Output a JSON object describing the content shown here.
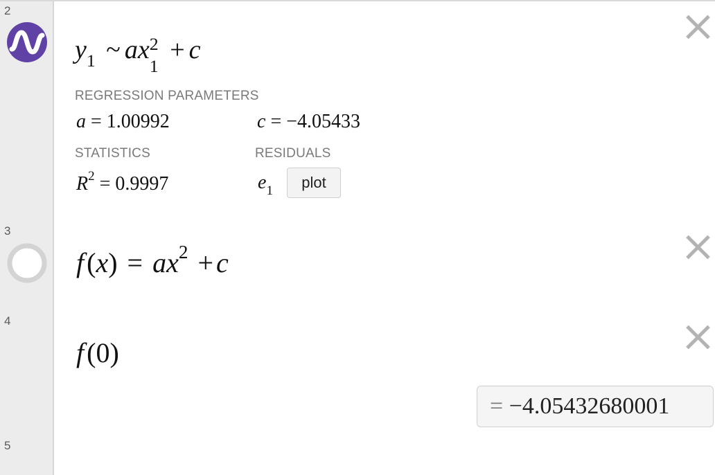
{
  "expressions": [
    {
      "number": "2",
      "type": "regression",
      "formula": {
        "y": "y",
        "y_sub": "1",
        "tilde": "~",
        "a": "a",
        "x": "x",
        "x_sup": "2",
        "x_sub": "1",
        "plus": "+",
        "c": "c"
      },
      "regression_parameters_label": "REGRESSION PARAMETERS",
      "param_a": {
        "name": "a",
        "eq": "=",
        "value": "1.00992"
      },
      "param_c": {
        "name": "c",
        "eq": "=",
        "value": "−4.05433"
      },
      "statistics_label": "STATISTICS",
      "r2": {
        "name": "R",
        "sup": "2",
        "eq": "=",
        "value": "0.9997"
      },
      "residuals_label": "RESIDUALS",
      "residual": {
        "name": "e",
        "sub": "1"
      },
      "plot_button": "plot",
      "icon": "regression-wave-icon",
      "icon_color": "#6042a6"
    },
    {
      "number": "3",
      "type": "function",
      "formula": {
        "f": "f",
        "lparen": "(",
        "x": "x",
        "rparen": ")",
        "eq": "=",
        "a": "a",
        "x2": "x",
        "sup": "2",
        "plus": "+",
        "c": "c"
      },
      "icon": "hidden-circle-icon"
    },
    {
      "number": "4",
      "type": "evaluation",
      "formula": {
        "f": "f",
        "lparen": "(",
        "arg": "0",
        "rparen": ")"
      },
      "result": {
        "eq": "=",
        "value": "−4.05432680001"
      }
    },
    {
      "number": "5",
      "type": "empty"
    }
  ],
  "colors": {
    "gutter": "#ececec",
    "border": "#d9d9d9",
    "close": "#b3b3b3",
    "icon_purple": "#6042a6"
  }
}
